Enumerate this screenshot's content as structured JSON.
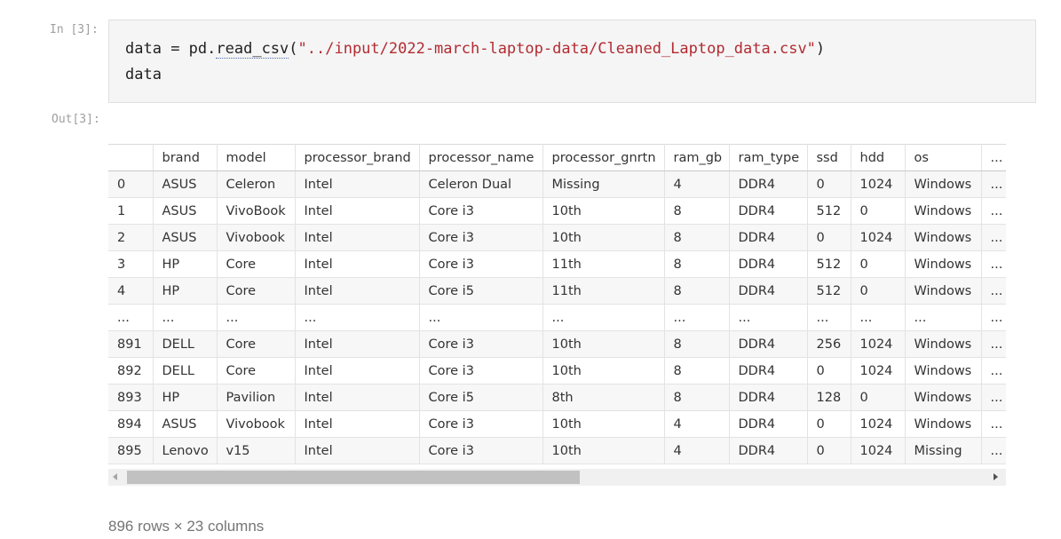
{
  "cell": {
    "input_prompt": "In [3]:",
    "output_prompt": "Out[3]:",
    "code": {
      "line1": {
        "var": "data",
        "op": " = ",
        "obj": "pd.",
        "fn": "read_csv",
        "open": "(",
        "path": "\"../input/2022-march-laptop-data/Cleaned_Laptop_data.csv\"",
        "close": ")"
      },
      "line2": "data"
    }
  },
  "dataframe": {
    "columns": [
      "",
      "brand",
      "model",
      "processor_brand",
      "processor_name",
      "processor_gnrtn",
      "ram_gb",
      "ram_type",
      "ssd",
      "hdd",
      "os",
      "..."
    ],
    "rows": [
      [
        "0",
        "ASUS",
        "Celeron",
        "Intel",
        "Celeron Dual",
        "Missing",
        "4",
        "DDR4",
        "0",
        "1024",
        "Windows",
        "..."
      ],
      [
        "1",
        "ASUS",
        "VivoBook",
        "Intel",
        "Core i3",
        "10th",
        "8",
        "DDR4",
        "512",
        "0",
        "Windows",
        "..."
      ],
      [
        "2",
        "ASUS",
        "Vivobook",
        "Intel",
        "Core i3",
        "10th",
        "8",
        "DDR4",
        "0",
        "1024",
        "Windows",
        "..."
      ],
      [
        "3",
        "HP",
        "Core",
        "Intel",
        "Core i3",
        "11th",
        "8",
        "DDR4",
        "512",
        "0",
        "Windows",
        "..."
      ],
      [
        "4",
        "HP",
        "Core",
        "Intel",
        "Core i5",
        "11th",
        "8",
        "DDR4",
        "512",
        "0",
        "Windows",
        "..."
      ],
      [
        "...",
        "...",
        "...",
        "...",
        "...",
        "...",
        "...",
        "...",
        "...",
        "...",
        "...",
        "..."
      ],
      [
        "891",
        "DELL",
        "Core",
        "Intel",
        "Core i3",
        "10th",
        "8",
        "DDR4",
        "256",
        "1024",
        "Windows",
        "..."
      ],
      [
        "892",
        "DELL",
        "Core",
        "Intel",
        "Core i3",
        "10th",
        "8",
        "DDR4",
        "0",
        "1024",
        "Windows",
        "..."
      ],
      [
        "893",
        "HP",
        "Pavilion",
        "Intel",
        "Core i5",
        "8th",
        "8",
        "DDR4",
        "128",
        "0",
        "Windows",
        "..."
      ],
      [
        "894",
        "ASUS",
        "Vivobook",
        "Intel",
        "Core i3",
        "10th",
        "4",
        "DDR4",
        "0",
        "1024",
        "Windows",
        "..."
      ],
      [
        "895",
        "Lenovo",
        "v15",
        "Intel",
        "Core i3",
        "10th",
        "4",
        "DDR4",
        "0",
        "1024",
        "Missing",
        "..."
      ]
    ],
    "summary": "896 rows × 23 columns"
  }
}
